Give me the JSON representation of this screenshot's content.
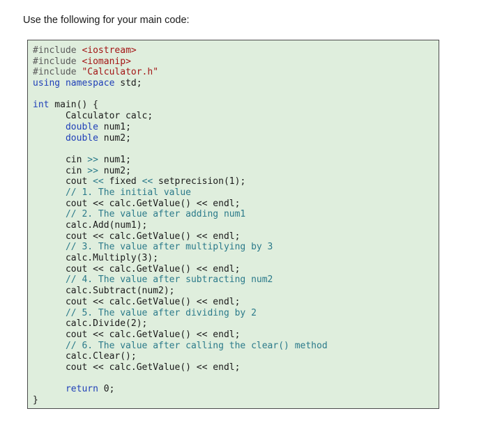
{
  "intro_text": "Use the following for your main code:",
  "code": {
    "line_01": {
      "a": "#include ",
      "b": "<iostream>"
    },
    "line_02": {
      "a": "#include ",
      "b": "<iomanip>"
    },
    "line_03": {
      "a": "#include ",
      "b": "\"Calculator.h\""
    },
    "line_04": {
      "a": "using",
      "b": " ",
      "c": "namespace",
      "d": " std;"
    },
    "line_06": {
      "a": "int",
      "b": " main() {"
    },
    "line_07": {
      "a": "Calculator calc;"
    },
    "line_08": {
      "a": "double",
      "b": " num1;"
    },
    "line_09": {
      "a": "double",
      "b": " num2;"
    },
    "line_11": {
      "a": "cin ",
      "b": ">>",
      "c": " num1;"
    },
    "line_12": {
      "a": "cin ",
      "b": ">>",
      "c": " num2;"
    },
    "line_13": {
      "a": "cout ",
      "b": "<<",
      "c": " fixed ",
      "d": "<<",
      "e": " setprecision(1);"
    },
    "line_14": {
      "a": "// 1. The initial value"
    },
    "line_15": {
      "a": "cout << calc.GetValue() << endl;"
    },
    "line_16": {
      "a": "// 2. The value after adding num1"
    },
    "line_17": {
      "a": "calc.Add(num1);"
    },
    "line_18": {
      "a": "cout << calc.GetValue() << endl;"
    },
    "line_19": {
      "a": "// 3. The value after multiplying by 3"
    },
    "line_20": {
      "a": "calc.Multiply(3);"
    },
    "line_21": {
      "a": "cout << calc.GetValue() << endl;"
    },
    "line_22": {
      "a": "// 4. The value after subtracting num2"
    },
    "line_23": {
      "a": "calc.Subtract(num2);"
    },
    "line_24": {
      "a": "cout << calc.GetValue() << endl;"
    },
    "line_25": {
      "a": "// 5. The value after dividing by 2"
    },
    "line_26": {
      "a": "calc.Divide(2);"
    },
    "line_27": {
      "a": "cout << calc.GetValue() << endl;"
    },
    "line_28": {
      "a": "// 6. The value after calling the clear() method"
    },
    "line_29": {
      "a": "calc.Clear();"
    },
    "line_30": {
      "a": "cout << calc.GetValue() << endl;"
    },
    "line_32": {
      "a": "return",
      "b": " 0;"
    },
    "line_33": {
      "a": "}"
    }
  },
  "colors": {
    "code_background": "#dfeedd",
    "keyword": "#1f3fb8",
    "string": "#a31515",
    "comment": "#2b7a8a"
  }
}
